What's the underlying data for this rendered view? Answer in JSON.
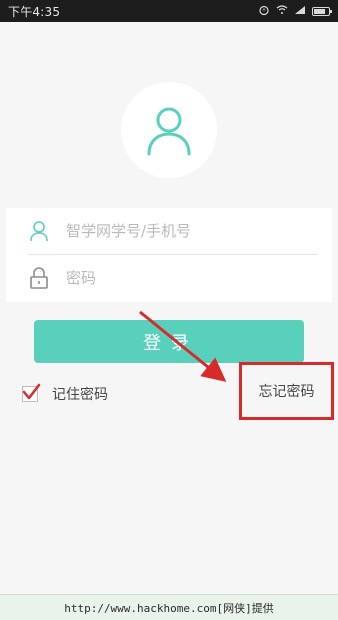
{
  "status_bar": {
    "time": "下午4:35",
    "icons": [
      "alarm-icon",
      "wifi-icon",
      "signal-icon",
      "battery-icon"
    ]
  },
  "login": {
    "username_placeholder": "智学网学号/手机号",
    "password_placeholder": "密码",
    "login_button": "登录",
    "remember_label": "记住密码",
    "remember_checked": true,
    "forgot_label": "忘记密码"
  },
  "footer": {
    "text": "http://www.hackhome.com[网侠]提供"
  },
  "colors": {
    "accent": "#59d0bc",
    "annotation_red": "#d82a2a"
  }
}
